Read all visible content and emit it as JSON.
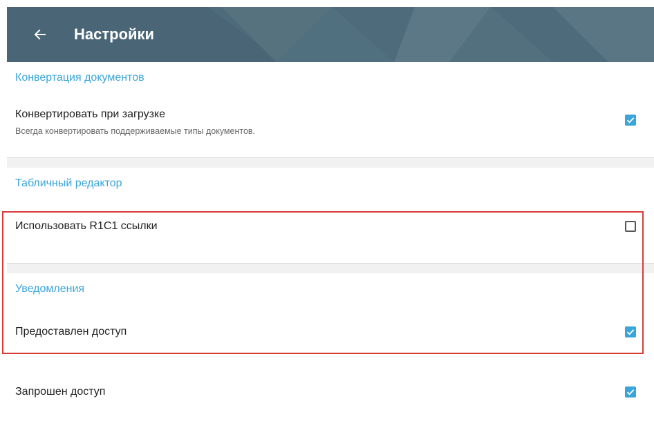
{
  "app_bar": {
    "title": "Настройки",
    "back_icon": "arrow-left-icon",
    "color": "#4e6b7c"
  },
  "accent_color": "#3aa5d8",
  "sections": [
    {
      "header": "Конвертация документов",
      "items": [
        {
          "title": "Конвертировать при загрузке",
          "summary": "Всегда конвертировать поддерживаемые типы документов.",
          "checked": true
        }
      ]
    },
    {
      "header": "Табличный редактор",
      "items": [
        {
          "title": "Использовать R1C1 ссылки",
          "checked": false
        }
      ]
    },
    {
      "header": "Уведомления",
      "items": [
        {
          "title": "Предоставлен доступ",
          "checked": true
        },
        {
          "title": "Запрошен доступ",
          "checked": true
        }
      ]
    }
  ],
  "highlight_color": "#d83a3a"
}
